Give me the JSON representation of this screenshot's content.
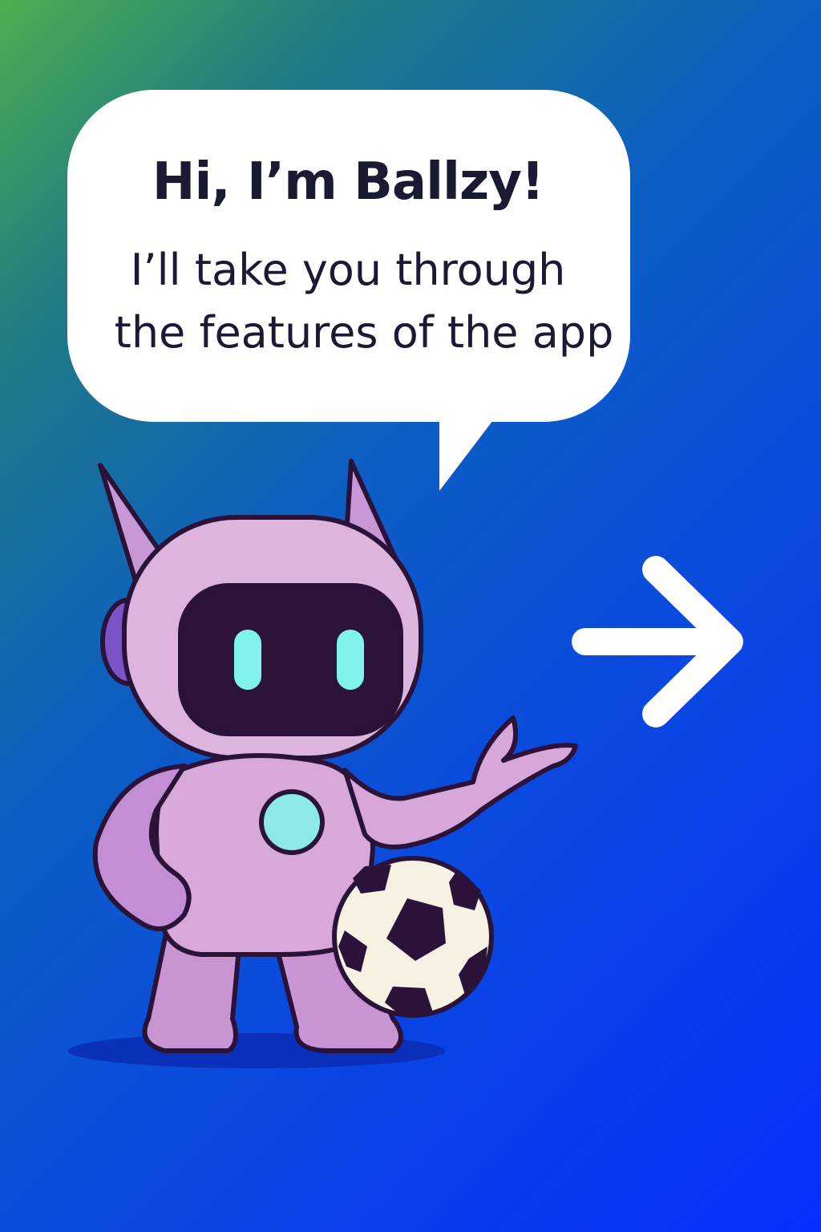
{
  "onboarding": {
    "greeting": "Hi, I’m Ballzy!",
    "message_line1": "I’ll take you through",
    "message_line2": "the features of the app",
    "next_icon": "arrow-right-icon"
  },
  "colors": {
    "bubble": "#ffffff",
    "text": "#1a1a33",
    "robot_body": "#d8b1dc",
    "robot_outline": "#2a1238",
    "visor": "#2b1438",
    "eyes": "#7ff3ec"
  }
}
